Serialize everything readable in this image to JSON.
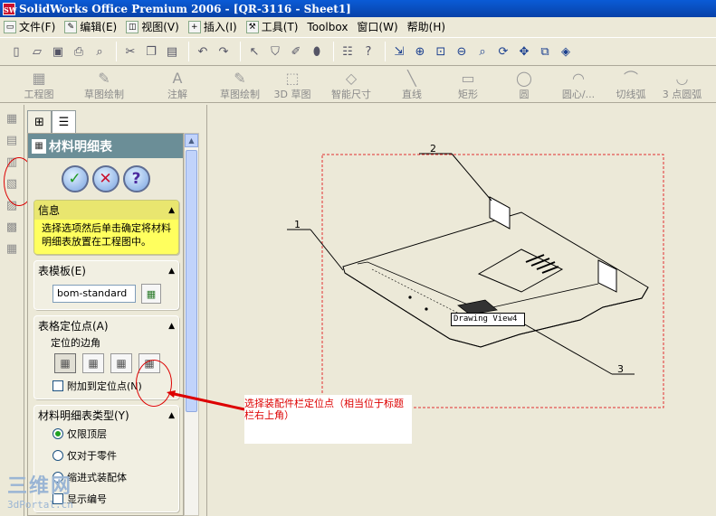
{
  "window": {
    "title": "SolidWorks Office Premium 2006 - [QR-3116 - Sheet1]",
    "app_icon": "SW"
  },
  "menu": [
    {
      "label": "文件(F)",
      "icon": "file-icon"
    },
    {
      "label": "编辑(E)",
      "icon": "edit-icon"
    },
    {
      "label": "视图(V)",
      "icon": "view-icon"
    },
    {
      "label": "插入(I)",
      "icon": "insert-icon"
    },
    {
      "label": "工具(T)",
      "icon": "tools-icon"
    },
    {
      "label": "Toolbox",
      "icon": ""
    },
    {
      "label": "窗口(W)",
      "icon": ""
    },
    {
      "label": "帮助(H)",
      "icon": ""
    }
  ],
  "command_manager": [
    {
      "label": "工程图",
      "icon": "drawing-icon"
    },
    {
      "label": "草图绘制",
      "icon": "sketch-icon"
    },
    {
      "label": "注解",
      "icon": "annotation-icon"
    },
    {
      "label": "草图绘制",
      "icon": "sketch-icon"
    },
    {
      "label": "3D 草图",
      "icon": "3d-sketch-icon"
    },
    {
      "label": "智能尺寸",
      "icon": "smart-dimension-icon"
    },
    {
      "label": "直线",
      "icon": "line-icon"
    },
    {
      "label": "矩形",
      "icon": "rectangle-icon"
    },
    {
      "label": "圆",
      "icon": "circle-icon"
    },
    {
      "label": "圆心/...",
      "icon": "centerpoint-arc-icon"
    },
    {
      "label": "切线弧",
      "icon": "tangent-arc-icon"
    },
    {
      "label": "3 点圆弧",
      "icon": "3point-arc-icon"
    }
  ],
  "panel": {
    "title": "材料明细表",
    "info": {
      "header": "信息",
      "text": "选择选项然后单击确定将材料明细表放置在工程图中。"
    },
    "template": {
      "header": "表模板(E)",
      "value": "bom-standard"
    },
    "anchor": {
      "header": "表格定位点(A)",
      "sublabel": "定位的边角",
      "attach_label": "附加到定位点(N)",
      "selected_corner": 4
    },
    "bom_type": {
      "header": "材料明细表类型(Y)",
      "options": [
        "仅限顶层",
        "仅对于零件",
        "缩进式装配体"
      ],
      "selected": 0,
      "next_label": "显示编号"
    }
  },
  "drawing": {
    "tooltip": "Drawing View4",
    "balloons": [
      "1",
      "2",
      "3"
    ]
  },
  "annotation": {
    "callout": "选择装配件栏定位点（相当位于标题栏右上角）"
  },
  "watermark": {
    "big": "三维网",
    "small": "3dPortal.cn"
  },
  "colors": {
    "titlebar": "#0842a8",
    "panel_header": "#6b8e97",
    "info_bg": "#ffff5e",
    "annotation_red": "#dd0000"
  }
}
